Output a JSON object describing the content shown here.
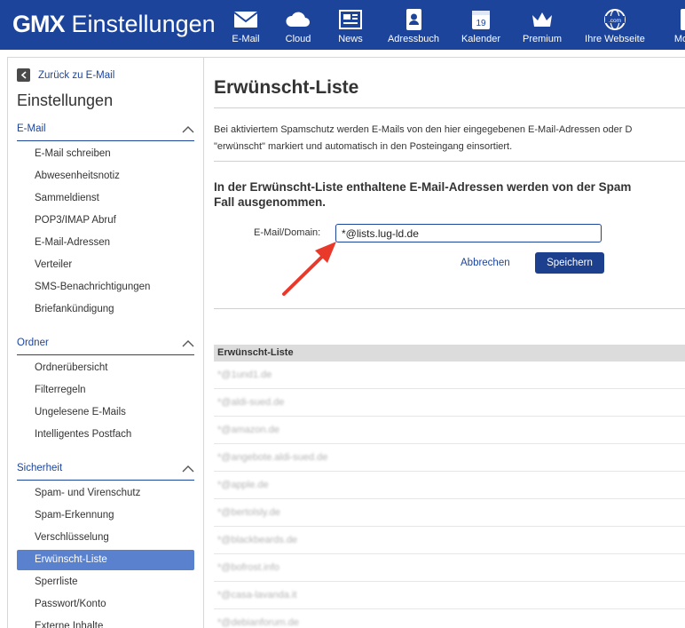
{
  "header": {
    "brand": "GMX",
    "title": "Einstellungen",
    "nav": [
      {
        "label": "E-Mail",
        "icon": "envelope-icon"
      },
      {
        "label": "Cloud",
        "icon": "cloud-icon"
      },
      {
        "label": "News",
        "icon": "news-icon"
      },
      {
        "label": "Adressbuch",
        "icon": "addressbook-icon"
      },
      {
        "label": "Kalender",
        "icon": "calendar-icon",
        "day": "19"
      },
      {
        "label": "Premium",
        "icon": "crown-icon"
      },
      {
        "label": "Ihre Webseite",
        "icon": "globe-icon",
        "badge": ".com"
      },
      {
        "label": "Mobil",
        "icon": "mobile-icon"
      }
    ]
  },
  "sidebar": {
    "back_label": "Zurück zu E-Mail",
    "title": "Einstellungen",
    "sections": [
      {
        "label": "E-Mail",
        "items": [
          "E-Mail schreiben",
          "Abwesenheitsnotiz",
          "Sammeldienst",
          "POP3/IMAP Abruf",
          "E-Mail-Adressen",
          "Verteiler",
          "SMS-Benachrichtigungen",
          "Briefankündigung"
        ]
      },
      {
        "label": "Ordner",
        "items": [
          "Ordnerübersicht",
          "Filterregeln",
          "Ungelesene E-Mails",
          "Intelligentes Postfach"
        ]
      },
      {
        "label": "Sicherheit",
        "items": [
          "Spam- und Virenschutz",
          "Spam-Erkennung",
          "Verschlüsselung",
          "Erwünscht-Liste",
          "Sperrliste",
          "Passwort/Konto",
          "Externe Inhalte"
        ]
      }
    ],
    "active_item": "Erwünscht-Liste"
  },
  "main": {
    "title": "Erwünscht-Liste",
    "intro_line1": "Bei aktiviertem Spamschutz werden E-Mails von den hier eingegebenen E-Mail-Adressen oder D",
    "intro_line2": "\"erwünscht\" markiert und automatisch in den Posteingang einsortiert.",
    "heading_line1": "In der Erwünscht-Liste enthaltene E-Mail-Adressen werden von der Spam",
    "heading_line2": "Fall ausgenommen.",
    "form": {
      "label": "E-Mail/Domain:",
      "value": "*@lists.lug-ld.de",
      "cancel": "Abbrechen",
      "save": "Speichern"
    },
    "list_header": "Erwünscht-Liste",
    "entries": [
      "*@1und1.de",
      "*@aldi-sued.de",
      "*@amazon.de",
      "*@angebote.aldi-sued.de",
      "*@apple.de",
      "*@bertolsly.de",
      "*@blackbeards.de",
      "*@bofrost.info",
      "*@casa-lavanda.it",
      "*@debianforum.de"
    ]
  },
  "colors": {
    "brand_blue": "#1c449b",
    "active_item": "#5a81cd",
    "annotation_arrow": "#e8392b"
  }
}
